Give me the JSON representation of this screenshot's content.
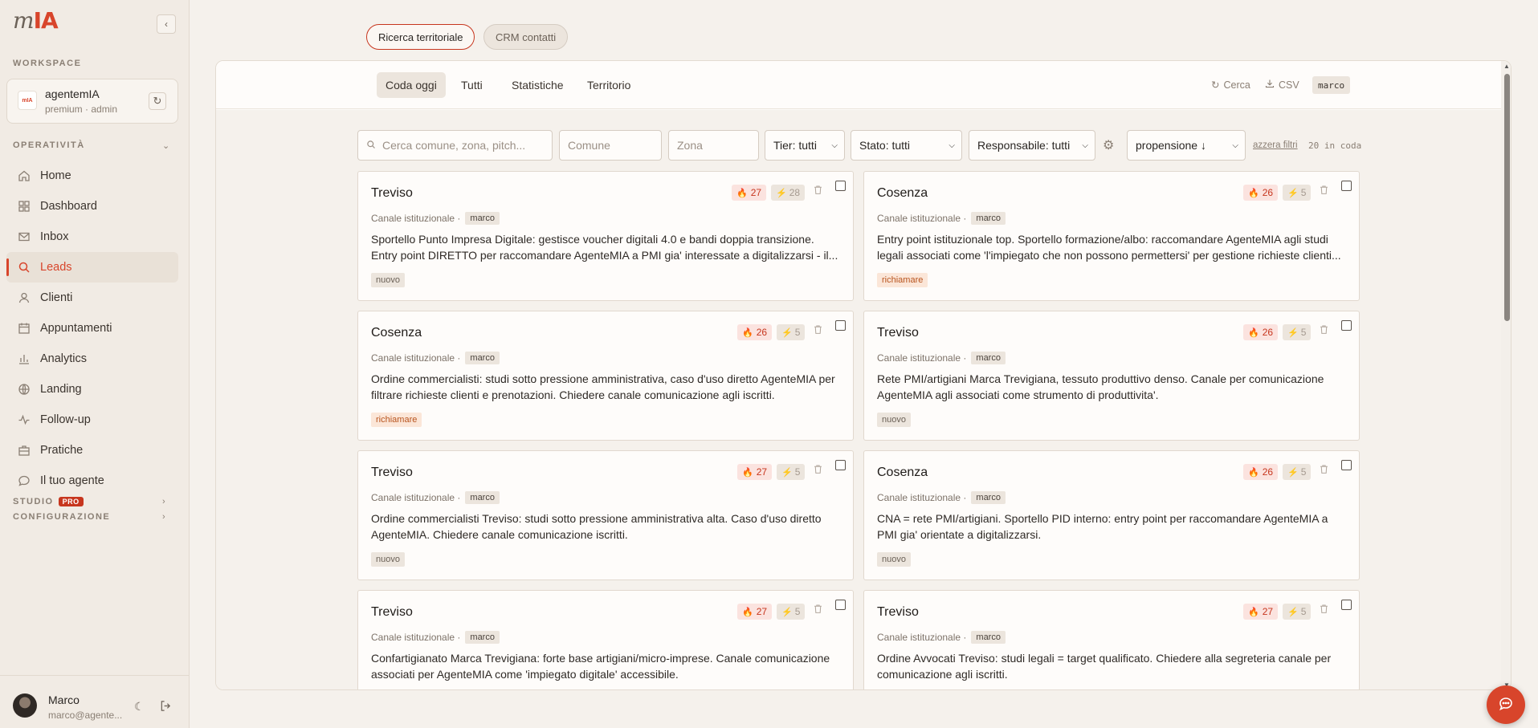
{
  "brand": {
    "logo_m": "m",
    "logo_ia": "IA"
  },
  "sidebar": {
    "workspace_label": "WORKSPACE",
    "workspace": {
      "logo_text": "mIA",
      "name": "agentemIA",
      "sub": "premium · admin"
    },
    "operativita_label": "OPERATIVITÀ",
    "items": [
      {
        "label": "Home",
        "icon": "home-icon"
      },
      {
        "label": "Dashboard",
        "icon": "dashboard-icon"
      },
      {
        "label": "Inbox",
        "icon": "mail-icon"
      },
      {
        "label": "Leads",
        "icon": "search-icon",
        "active": true
      },
      {
        "label": "Clienti",
        "icon": "user-icon"
      },
      {
        "label": "Appuntamenti",
        "icon": "calendar-icon"
      },
      {
        "label": "Analytics",
        "icon": "bar-chart-icon"
      },
      {
        "label": "Landing",
        "icon": "globe-icon"
      },
      {
        "label": "Follow-up",
        "icon": "activity-icon"
      },
      {
        "label": "Pratiche",
        "icon": "briefcase-icon"
      },
      {
        "label": "Il tuo agente",
        "icon": "chat-bubble-icon"
      }
    ],
    "studio_label": "STUDIO",
    "pro_badge": "PRO",
    "config_label": "CONFIGURAZIONE",
    "user": {
      "name": "Marco",
      "email": "marco@agente..."
    }
  },
  "top_pills": {
    "active": "Ricerca territoriale",
    "inactive": "CRM contatti"
  },
  "tabs": [
    "Coda oggi",
    "Tutti",
    "Statistiche",
    "Territorio"
  ],
  "toolbar": {
    "search": "Cerca",
    "csv": "CSV",
    "user_tag": "marco"
  },
  "filters": {
    "search_placeholder": "Cerca comune, zona, pitch...",
    "comune_placeholder": "Comune",
    "zona_placeholder": "Zona",
    "tier": "Tier: tutti",
    "stato": "Stato: tutti",
    "responsabile": "Responsabile: tutti",
    "sort": "propensione ↓",
    "reset": "azzera filtri",
    "queue_count": "20 in coda"
  },
  "cards": [
    {
      "city": "Treviso",
      "channel": "Canale istituzionale ·",
      "owner": "marco",
      "score_hot": "27",
      "score_cold": "28",
      "status": "nuovo",
      "text": "Sportello Punto Impresa Digitale: gestisce voucher digitali 4.0 e bandi doppia transizione. Entry point DIRETTO per raccomandare AgenteMIA a PMI gia' interessate a digitalizzarsi - il..."
    },
    {
      "city": "Cosenza",
      "channel": "Canale istituzionale ·",
      "owner": "marco",
      "score_hot": "26",
      "score_cold": "5",
      "status": "richiamare",
      "text": "Entry point istituzionale top. Sportello formazione/albo: raccomandare AgenteMIA agli studi legali associati come 'l'impiegato che non possono permettersi' per gestione richieste clienti..."
    },
    {
      "city": "Cosenza",
      "channel": "Canale istituzionale ·",
      "owner": "marco",
      "score_hot": "26",
      "score_cold": "5",
      "status": "richiamare",
      "text": "Ordine commercialisti: studi sotto pressione amministrativa, caso d'uso diretto AgenteMIA per filtrare richieste clienti e prenotazioni. Chiedere canale comunicazione agli iscritti."
    },
    {
      "city": "Treviso",
      "channel": "Canale istituzionale ·",
      "owner": "marco",
      "score_hot": "26",
      "score_cold": "5",
      "status": "nuovo",
      "text": "Rete PMI/artigiani Marca Trevigiana, tessuto produttivo denso. Canale per comunicazione AgenteMIA agli associati come strumento di produttivita'."
    },
    {
      "city": "Treviso",
      "channel": "Canale istituzionale ·",
      "owner": "marco",
      "score_hot": "27",
      "score_cold": "5",
      "status": "nuovo",
      "text": "Ordine commercialisti Treviso: studi sotto pressione amministrativa alta. Caso d'uso diretto AgenteMIA. Chiedere canale comunicazione iscritti."
    },
    {
      "city": "Cosenza",
      "channel": "Canale istituzionale ·",
      "owner": "marco",
      "score_hot": "26",
      "score_cold": "5",
      "status": "nuovo",
      "text": "CNA = rete PMI/artigiani. Sportello PID interno: entry point per raccomandare AgenteMIA a PMI gia' orientate a digitalizzarsi."
    },
    {
      "city": "Treviso",
      "channel": "Canale istituzionale ·",
      "owner": "marco",
      "score_hot": "27",
      "score_cold": "5",
      "status": "",
      "text": "Confartigianato Marca Trevigiana: forte base artigiani/micro-imprese. Canale comunicazione associati per AgenteMIA come 'impiegato digitale' accessibile."
    },
    {
      "city": "Treviso",
      "channel": "Canale istituzionale ·",
      "owner": "marco",
      "score_hot": "27",
      "score_cold": "5",
      "status": "",
      "text": "Ordine Avvocati Treviso: studi legali = target qualificato. Chiedere alla segreteria canale per comunicazione agli iscritti."
    }
  ],
  "colors": {
    "accent": "#d8452b",
    "sidebar_bg": "#f1ebe4",
    "page_bg": "#f5f1ec"
  }
}
